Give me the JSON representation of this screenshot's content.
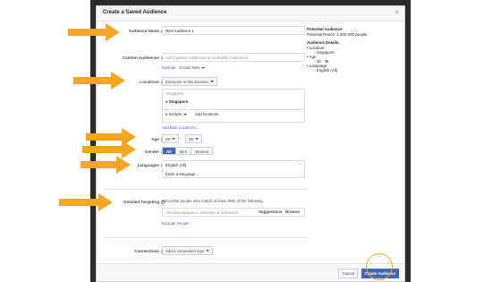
{
  "dialog": {
    "title": "Create a Saved Audience",
    "close_glyph": "×"
  },
  "form": {
    "audience_name": {
      "label": "Audience Name",
      "value": "New Audience 1"
    },
    "custom_audiences": {
      "label": "Custom Audiences",
      "placeholder": "Add Custom Audiences or Lookalike Audiences",
      "exclude_link": "Exclude",
      "create_new_label": "Create New"
    },
    "locations": {
      "label": "Locations",
      "mode_select": "Everyone in this location",
      "group_name": "Singapore",
      "location_item": "Singapore",
      "include_select": "Include",
      "add_locations_placeholder": "Add locations",
      "add_bulk_link": "Add Bulk Locations..."
    },
    "age": {
      "label": "Age",
      "min": "25",
      "max": "35",
      "dash": "-"
    },
    "gender": {
      "label": "Gender",
      "options": [
        "All",
        "Men",
        "Women"
      ],
      "selected": "All"
    },
    "languages": {
      "label": "Languages",
      "tag": "English (All)",
      "placeholder": "Enter a language..."
    },
    "detailed_targeting": {
      "label": "Detailed Targeting",
      "description": "INCLUDE people who match at least ONE of the following",
      "placeholder": "Add demographics, interests or behaviors",
      "suggestions_label": "Suggestions",
      "browse_label": "Browse",
      "exclude_link": "Exclude People"
    },
    "connections": {
      "label": "Connections",
      "select_label": "Add a connection type"
    }
  },
  "summary": {
    "potential_audience_title": "Potential Audience:",
    "potential_reach": "Potential Reach: 1,500,000 people",
    "details_title": "Audience Details:",
    "location_label": "Location:",
    "location_value": "Singapore",
    "age_label": "Age",
    "age_value": "25 - 35",
    "language_label": "Language:",
    "language_value": "English (All)"
  },
  "footer": {
    "cancel_label": "Cancel",
    "create_label": "Create Audience"
  },
  "colors": {
    "accent_blue": "#4267b2",
    "annotation_orange": "#f6a623",
    "backdrop": "#2b2b2b"
  }
}
